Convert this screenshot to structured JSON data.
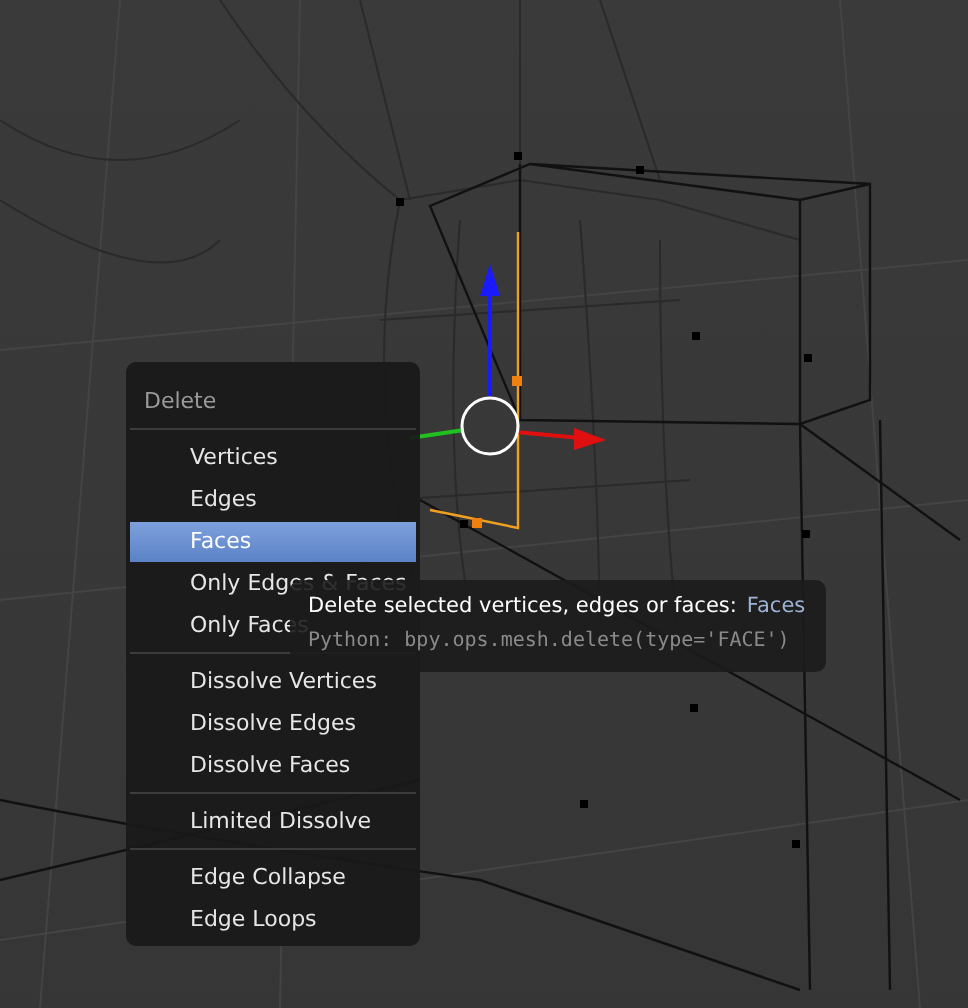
{
  "menu": {
    "title": "Delete",
    "sections": [
      [
        {
          "label": "Vertices",
          "selected": false
        },
        {
          "label": "Edges",
          "selected": false
        },
        {
          "label": "Faces",
          "selected": true
        },
        {
          "label": "Only Edges & Faces",
          "selected": false
        },
        {
          "label": "Only Faces",
          "selected": false
        }
      ],
      [
        {
          "label": "Dissolve Vertices",
          "selected": false
        },
        {
          "label": "Dissolve Edges",
          "selected": false
        },
        {
          "label": "Dissolve Faces",
          "selected": false
        }
      ],
      [
        {
          "label": "Limited Dissolve",
          "selected": false
        }
      ],
      [
        {
          "label": "Edge Collapse",
          "selected": false
        },
        {
          "label": "Edge Loops",
          "selected": false
        }
      ]
    ]
  },
  "tooltip": {
    "description": "Delete selected vertices, edges or faces:",
    "value": "Faces",
    "python": "Python: bpy.ops.mesh.delete(type='FACE')"
  }
}
